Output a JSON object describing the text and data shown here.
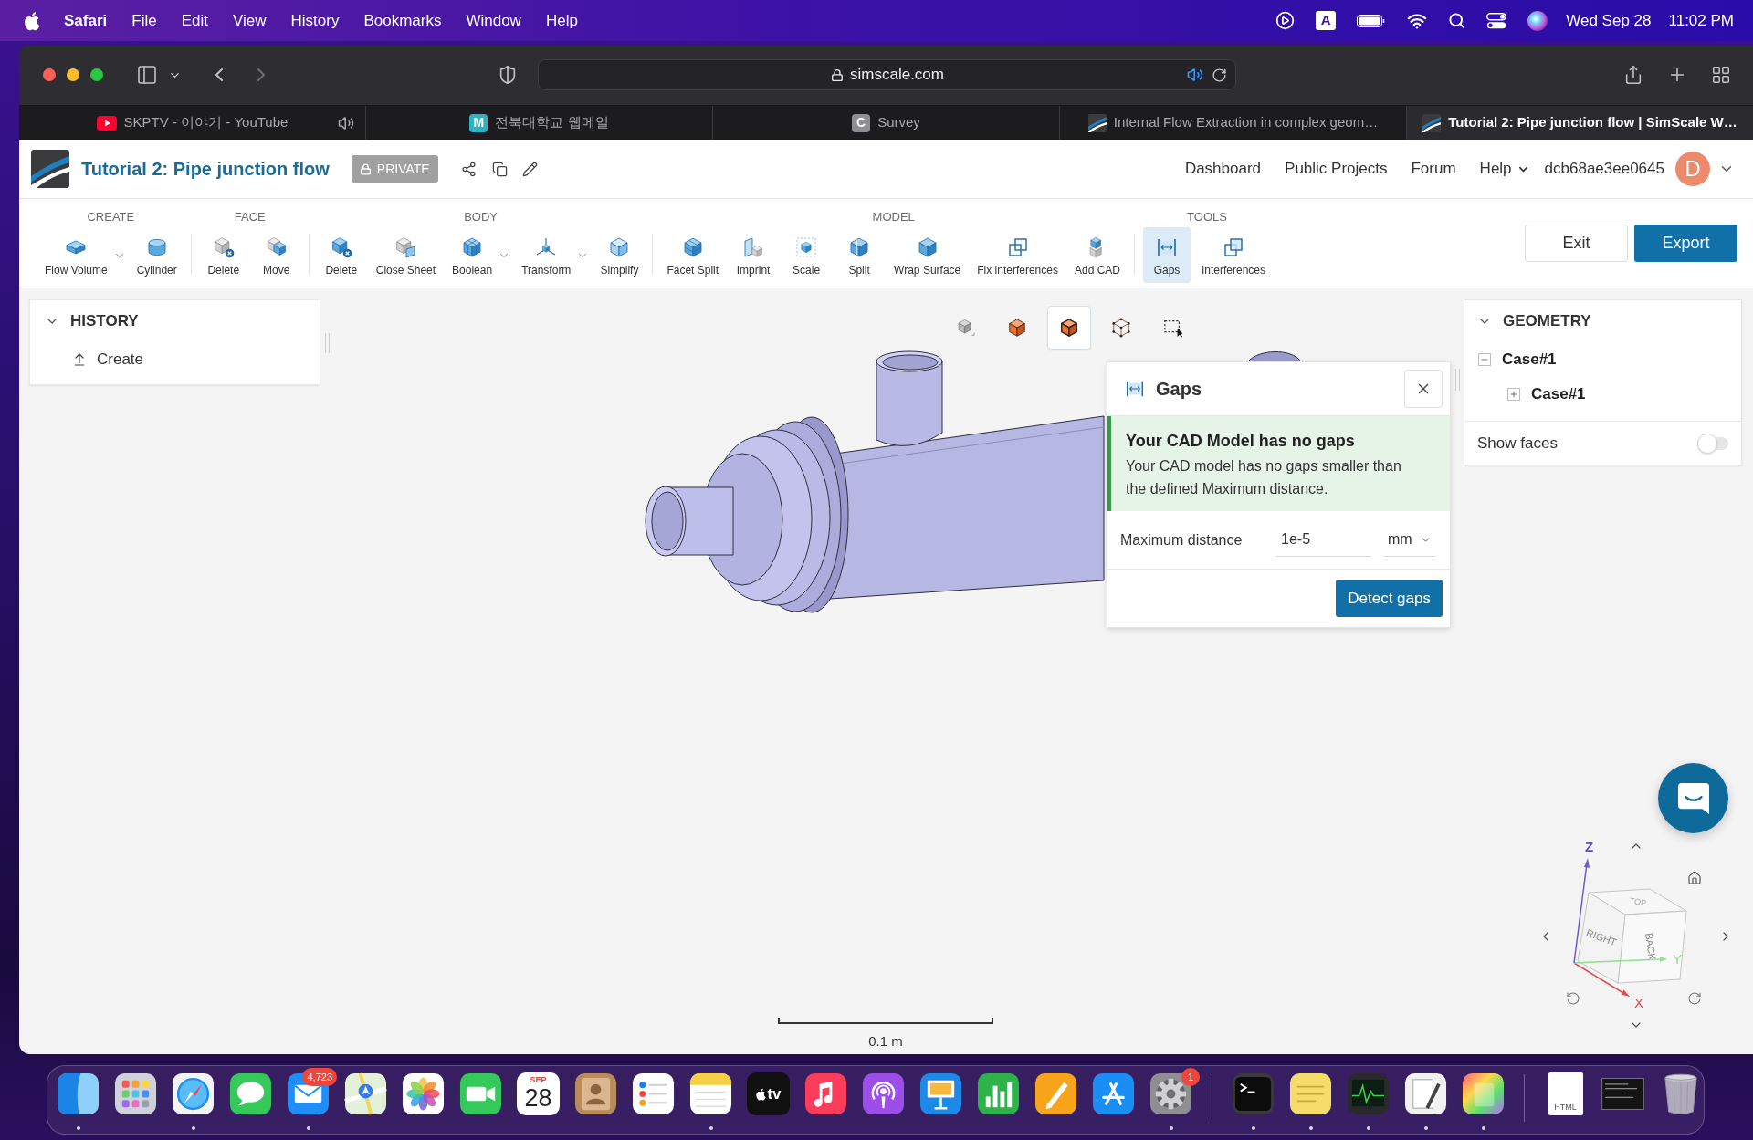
{
  "menu_bar": {
    "app": "Safari",
    "menus": [
      "File",
      "Edit",
      "View",
      "History",
      "Bookmarks",
      "Window",
      "Help"
    ],
    "input_source": "A",
    "date": "Wed Sep 28",
    "time": "11:02 PM"
  },
  "browser": {
    "address_bar": {
      "url": "simscale.com",
      "audio": true
    },
    "tabs": [
      {
        "kind": "video",
        "title": "SKPTV - 이야기 - YouTube",
        "selected": false,
        "audio": true
      },
      {
        "kind": "letter",
        "favicon_text": "M",
        "color": "#2bb3c2",
        "title": "전북대학교 웹메일",
        "selected": false,
        "audio": false
      },
      {
        "kind": "letter",
        "favicon_text": "C",
        "color": "#8e8e93",
        "title": "Survey",
        "selected": false,
        "audio": false
      },
      {
        "kind": "logo",
        "title": "Internal Flow Extraction in complex geom…",
        "selected": false,
        "audio": false
      },
      {
        "kind": "logo",
        "title": "Tutorial 2: Pipe junction flow | SimScale W…",
        "selected": true,
        "audio": false
      }
    ]
  },
  "app_header": {
    "title": "Tutorial 2: Pipe junction flow",
    "badge": "PRIVATE",
    "nav": [
      {
        "label": "Dashboard",
        "dropdown": false
      },
      {
        "label": "Public Projects",
        "dropdown": false
      },
      {
        "label": "Forum",
        "dropdown": false
      },
      {
        "label": "Help",
        "dropdown": true
      }
    ],
    "user": "dcb68ae3ee0645",
    "avatar": "D"
  },
  "toolbar": {
    "groups": [
      {
        "label": "CREATE",
        "tools": [
          {
            "label": "Flow Volume",
            "dropdown": true,
            "selected": false
          },
          {
            "label": "Cylinder",
            "dropdown": false,
            "selected": false
          }
        ]
      },
      {
        "label": "FACE",
        "tools": [
          {
            "label": "Delete",
            "dropdown": false,
            "selected": false
          },
          {
            "label": "Move",
            "dropdown": false,
            "selected": false
          }
        ]
      },
      {
        "label": "BODY",
        "tools": [
          {
            "label": "Delete",
            "dropdown": false,
            "selected": false
          },
          {
            "label": "Close Sheet",
            "dropdown": false,
            "selected": false
          },
          {
            "label": "Boolean",
            "dropdown": true,
            "selected": false
          },
          {
            "label": "Transform",
            "dropdown": true,
            "selected": false
          },
          {
            "label": "Simplify",
            "dropdown": false,
            "selected": false
          }
        ]
      },
      {
        "label": "MODEL",
        "tools": [
          {
            "label": "Facet Split",
            "dropdown": false,
            "selected": false
          },
          {
            "label": "Imprint",
            "dropdown": false,
            "selected": false
          },
          {
            "label": "Scale",
            "dropdown": false,
            "selected": false
          },
          {
            "label": "Split",
            "dropdown": false,
            "selected": false
          },
          {
            "label": "Wrap Surface",
            "dropdown": false,
            "selected": false
          },
          {
            "label": "Fix interferences",
            "dropdown": false,
            "selected": false
          },
          {
            "label": "Add CAD",
            "dropdown": false,
            "selected": false
          }
        ]
      },
      {
        "label": "TOOLS",
        "tools": [
          {
            "label": "Gaps",
            "dropdown": false,
            "selected": true
          },
          {
            "label": "Interferences",
            "dropdown": false,
            "selected": false
          }
        ]
      }
    ],
    "actions": [
      {
        "label": "Exit",
        "kind": "secondary"
      },
      {
        "label": "Export",
        "kind": "primary"
      }
    ]
  },
  "history": {
    "title": "HISTORY",
    "expanded": true,
    "items": [
      "Create"
    ]
  },
  "view_modes": [
    {
      "selected": false
    },
    {
      "selected": false
    },
    {
      "selected": true
    },
    {
      "selected": false
    },
    {
      "selected": false
    }
  ],
  "gaps_panel": {
    "title": "Gaps",
    "alert": {
      "title": "Your CAD Model has no gaps",
      "text": "Your CAD model has no gaps smaller than the defined Maximum distance."
    },
    "field": {
      "label": "Maximum distance",
      "value": "1e-5",
      "unit": "mm"
    },
    "button": "Detect gaps"
  },
  "geometry": {
    "title": "GEOMETRY",
    "expanded": true,
    "tree": [
      {
        "label": "Case#1",
        "expanded": true,
        "children": [
          {
            "label": "Case#1",
            "expanded": false
          }
        ]
      }
    ],
    "show_faces": {
      "label": "Show faces",
      "on": false
    }
  },
  "view_cube": {
    "faces": [
      "RIGHT",
      "BACK",
      "TOP"
    ],
    "axes": [
      "X",
      "Y",
      "Z"
    ]
  },
  "scale_bar": {
    "label": "0.1 m"
  },
  "dock": {
    "apps": [
      {
        "running": true
      },
      {
        "running": false
      },
      {
        "running": true
      },
      {
        "running": false
      },
      {
        "running": true,
        "badge": "4,723"
      },
      {
        "running": false
      },
      {
        "running": false
      },
      {
        "running": false
      },
      {
        "running": false,
        "month": "SEP",
        "day": "28"
      },
      {
        "running": false
      },
      {
        "running": false
      },
      {
        "running": true
      },
      {
        "running": false,
        "label": "tv"
      },
      {
        "running": false
      },
      {
        "running": false
      },
      {
        "running": false
      },
      {
        "running": false
      },
      {
        "running": false
      },
      {
        "running": false
      },
      {
        "running": true,
        "badge": "1"
      }
    ],
    "utilities": [
      {
        "running": true
      },
      {
        "running": true
      },
      {
        "running": true
      },
      {
        "running": true
      },
      {
        "running": true
      }
    ],
    "others": [
      {
        "kind": "document",
        "label": "HTML"
      },
      {
        "kind": "thumbnail"
      },
      {
        "kind": "trash"
      }
    ]
  }
}
